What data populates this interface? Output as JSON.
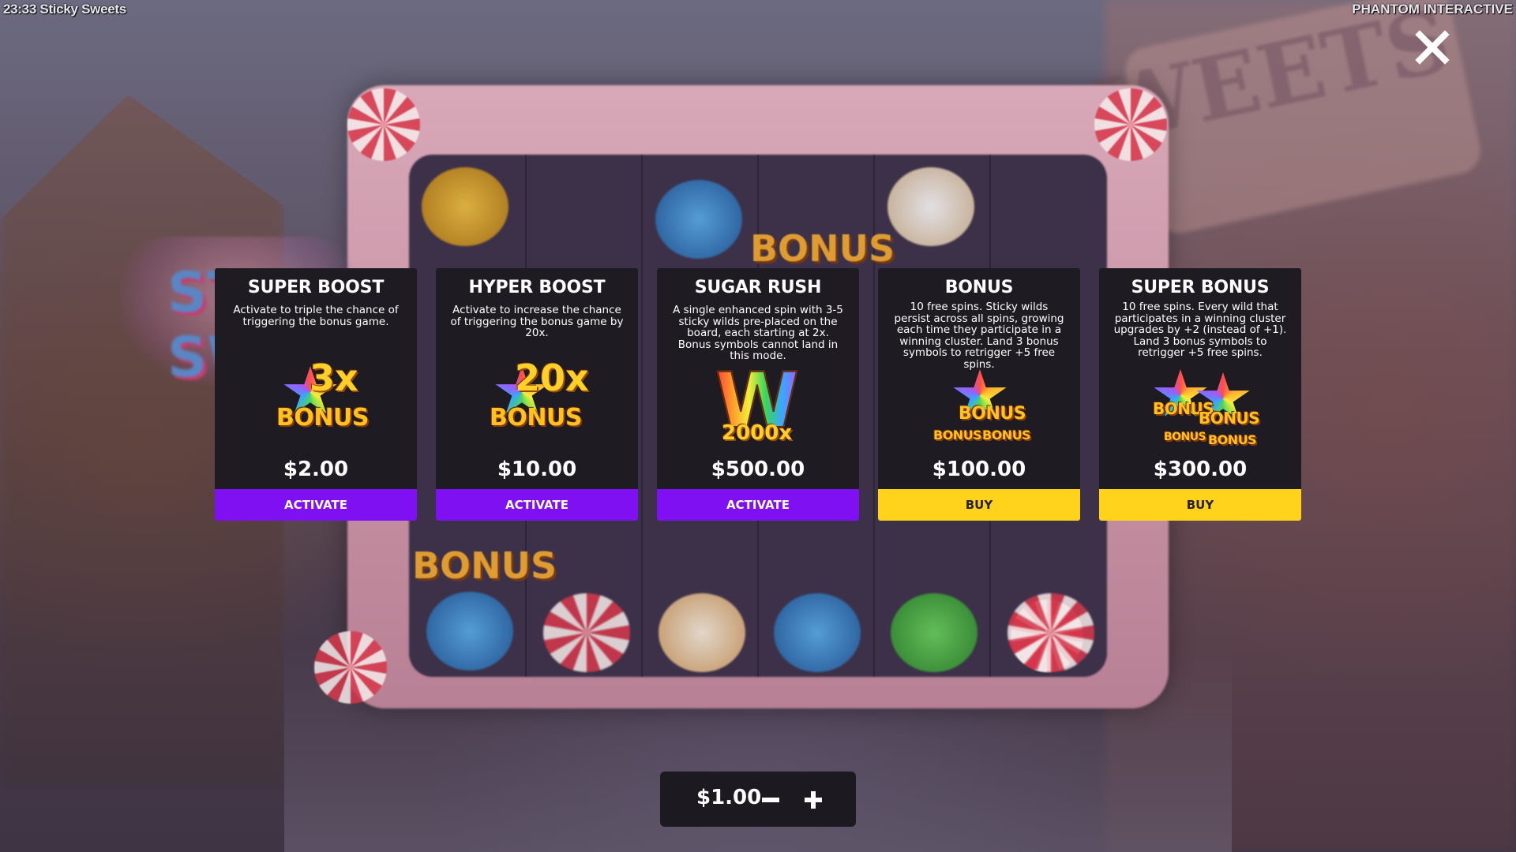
{
  "hud": {
    "left_text": "23:33 Sticky Sweets",
    "right_text": "PHANTOM INTERACTIVE"
  },
  "logo": {
    "text": "ST SW"
  },
  "board": {
    "bonus_symbol_text": "BONUS"
  },
  "cards": [
    {
      "title": "SUPER BOOST",
      "description": "Activate to triple the chance of triggering the bonus game.",
      "icon": "3x-bonus-star-icon",
      "icon_multiplier": "3x",
      "icon_label": "BONUS",
      "price": "$2.00",
      "button": "ACTIVATE",
      "button_color": "#7f10f2"
    },
    {
      "title": "HYPER BOOST",
      "description": "Activate to increase the chance of triggering the bonus game by 20x.",
      "icon": "20x-bonus-star-icon",
      "icon_multiplier": "20x",
      "icon_label": "BONUS",
      "price": "$10.00",
      "button": "ACTIVATE",
      "button_color": "#7f10f2"
    },
    {
      "title": "SUGAR RUSH",
      "description": "A single enhanced spin with 3-5 sticky wilds pre-placed on the board, each starting at 2x. Bonus symbols cannot land in this mode.",
      "icon": "wild-2000x-icon",
      "icon_letter": "W",
      "icon_multiplier": "2000x",
      "price": "$500.00",
      "button": "ACTIVATE",
      "button_color": "#7f10f2"
    },
    {
      "title": "BONUS",
      "description": "10 free spins. Sticky wilds persist across all spins, growing each time they participate in a winning cluster. Land 3 bonus symbols to retrigger +5 free spins.",
      "icon": "triple-bonus-symbol-icon",
      "icon_label": "BONUS",
      "price": "$100.00",
      "button": "BUY",
      "button_color": "#ffd21c"
    },
    {
      "title": "SUPER BONUS",
      "description": "10 free spins. Every wild that participates in a winning cluster upgrades by +2 (instead of +1). Land 3 bonus symbols to retrigger +5 free spins.",
      "icon": "quad-bonus-symbol-icon",
      "icon_label": "BONUS",
      "price": "$300.00",
      "button": "BUY",
      "button_color": "#ffd21c"
    }
  ],
  "bet": {
    "value": "$1.00"
  },
  "colors": {
    "activate": "#7f10f2",
    "buy": "#ffd21c",
    "card_bg": "#1e1b22"
  }
}
